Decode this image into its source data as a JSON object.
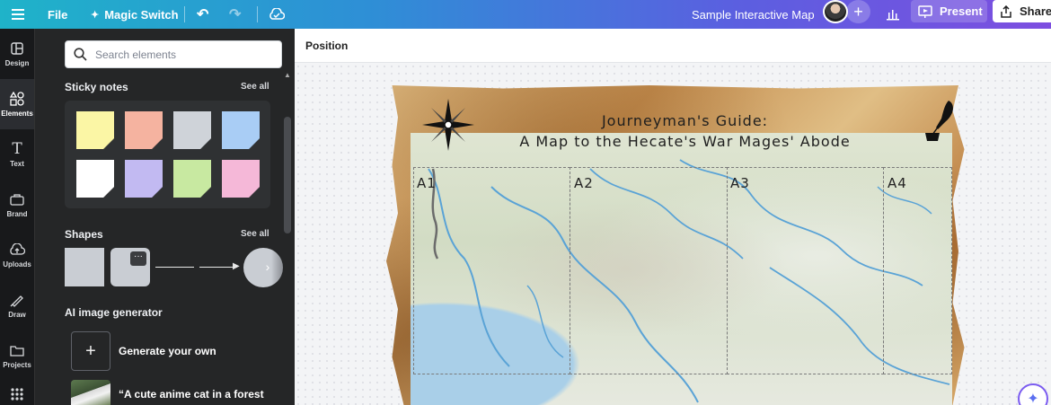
{
  "topbar": {
    "menu_icon": "hamburger-icon",
    "file": "File",
    "magic_switch": "Magic Switch",
    "doc_title": "Sample Interactive Map",
    "present": "Present",
    "share": "Share",
    "gradient_colors": [
      "#1fb3c9",
      "#2e8fd6",
      "#5b5fe0",
      "#7d4ee0"
    ]
  },
  "rail": {
    "items": [
      {
        "label": "Design",
        "icon": "layout-icon"
      },
      {
        "label": "Elements",
        "icon": "shapes-icon",
        "active": true
      },
      {
        "label": "Text",
        "icon": "text-icon"
      },
      {
        "label": "Brand",
        "icon": "briefcase-icon"
      },
      {
        "label": "Uploads",
        "icon": "cloud-upload-icon"
      },
      {
        "label": "Draw",
        "icon": "pen-icon"
      },
      {
        "label": "Projects",
        "icon": "folder-icon"
      }
    ]
  },
  "panel": {
    "search_placeholder": "Search elements",
    "sticky_notes": {
      "title": "Sticky notes",
      "see_all": "See all",
      "colors": [
        "#fbf6a5",
        "#f5b3a0",
        "#cfd3d9",
        "#a9cdf5",
        "#ffffff",
        "#c2baf2",
        "#c8e9a1",
        "#f5b8d8"
      ]
    },
    "shapes": {
      "title": "Shapes",
      "see_all": "See all"
    },
    "ai_generator": {
      "title": "AI image generator",
      "generate_label": "Generate your own",
      "sample_label": "“A cute anime cat in a forest"
    }
  },
  "canvas": {
    "position_label": "Position",
    "map": {
      "title_line1": "Journeyman's Guide:",
      "title_line2": "A Map to the Hecate's War Mages' Abode",
      "cells": [
        "A1",
        "A2",
        "A3",
        "A4"
      ]
    }
  }
}
